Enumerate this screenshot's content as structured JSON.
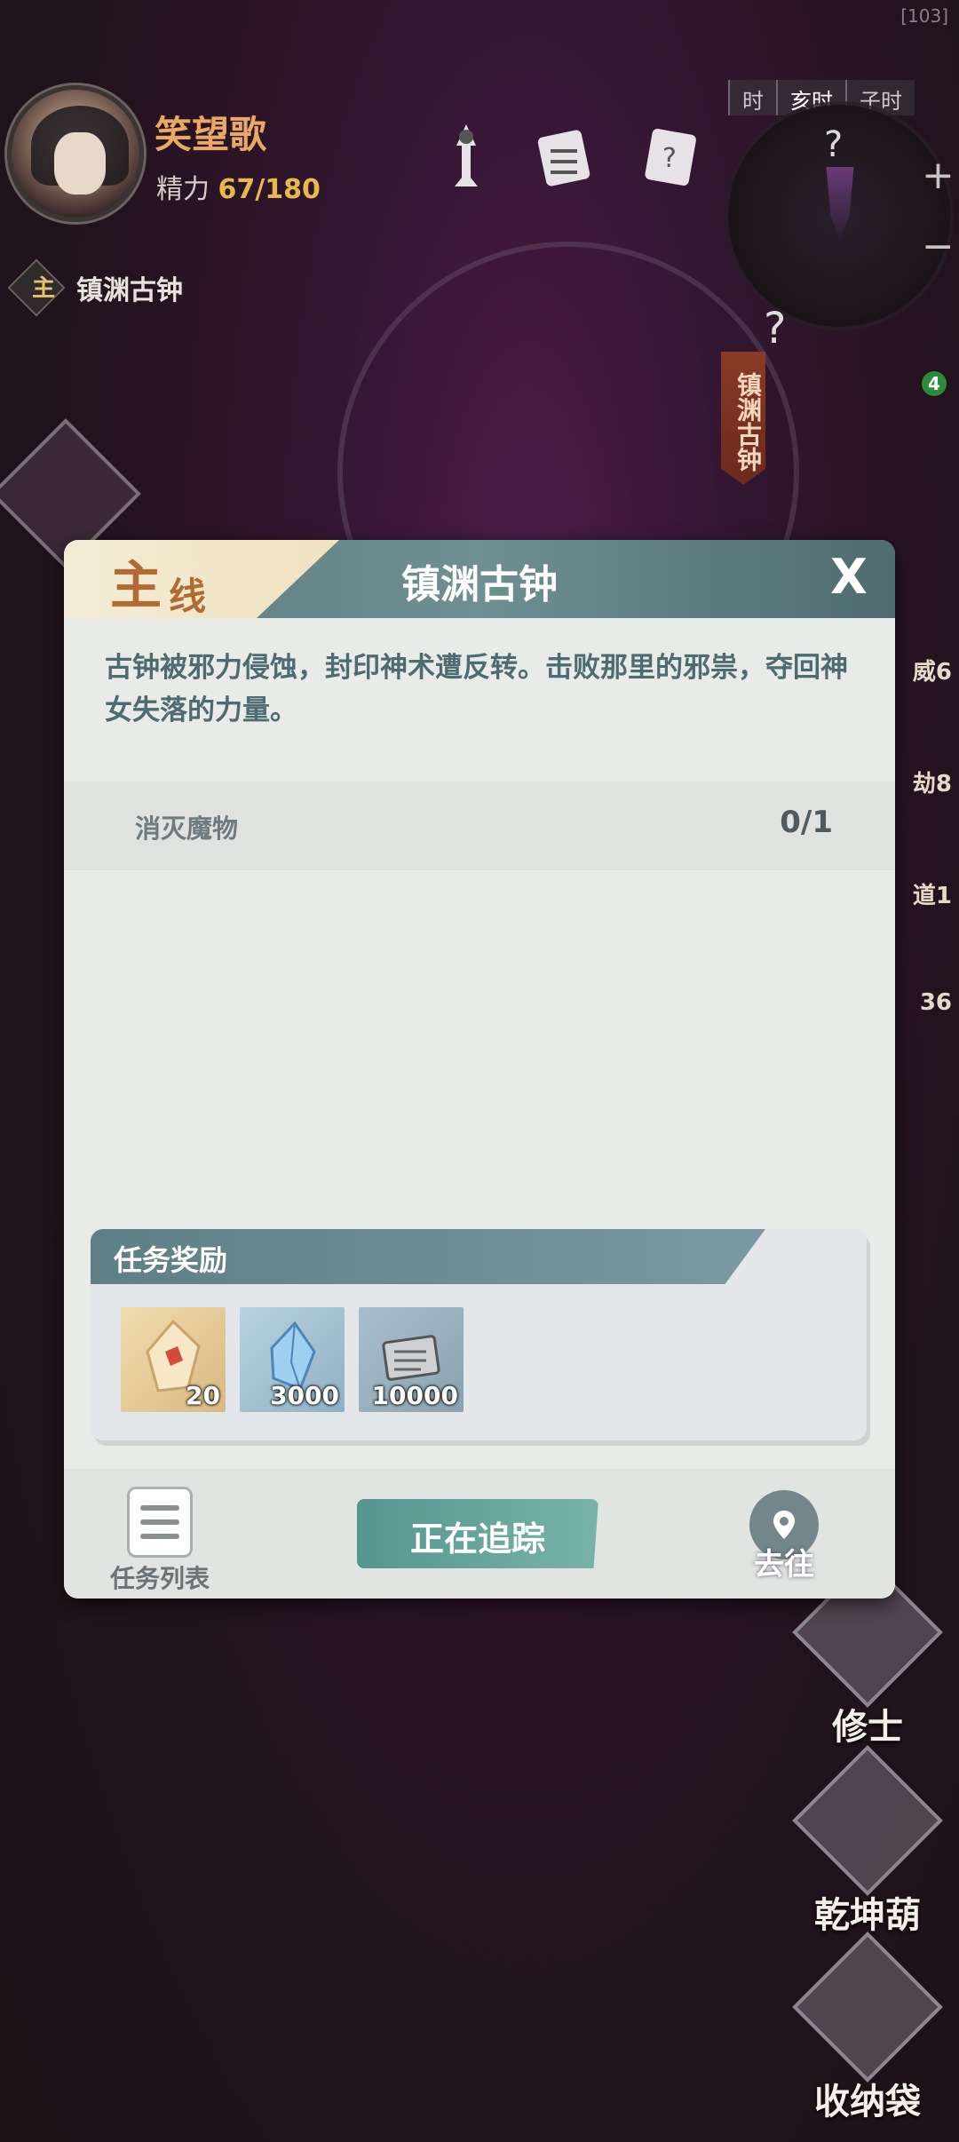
{
  "hud": {
    "debug_tag": "[103]",
    "player_name": "笑望歌",
    "energy_label": "精力",
    "energy_value": "67/180",
    "time_slots": [
      "时",
      "亥时",
      "子时"
    ],
    "minimap_unknown": "?",
    "zoom_in": "+",
    "zoom_out": "−",
    "tracked_quest_tag": "主",
    "tracked_quest_title": "镇渊古钟",
    "map_banner": "镇渊古钟",
    "map_banner_unknown": "?",
    "notification_badge": "4",
    "side_counters": [
      "威6",
      "劫8",
      "道1",
      "36"
    ]
  },
  "right_menu": [
    {
      "label": "修士"
    },
    {
      "label": "乾坤葫"
    },
    {
      "label": "收纳袋"
    }
  ],
  "dialog": {
    "tab_main": "主",
    "tab_line": "线",
    "title": "镇渊古钟",
    "close_label": "X",
    "description": "古钟被邪力侵蚀，封印神术遭反转。击败那里的邪祟，夺回神女失落的力量。",
    "objectives": [
      {
        "name": "消灭魔物",
        "progress": "0/1"
      }
    ],
    "rewards_title": "任务奖励",
    "rewards": [
      {
        "icon": "gold-crystal-icon",
        "count": "20"
      },
      {
        "icon": "blue-crystal-icon",
        "count": "3000"
      },
      {
        "icon": "scroll-icon",
        "count": "10000"
      }
    ],
    "footer": {
      "list_label": "任务列表",
      "track_label": "正在追踪",
      "goto_label": "去往"
    }
  },
  "colors": {
    "accent_teal": "#5f9a92",
    "header_slate": "#5b7b80",
    "gold_text": "#e8b84d",
    "tab_brown": "#b26a33"
  }
}
